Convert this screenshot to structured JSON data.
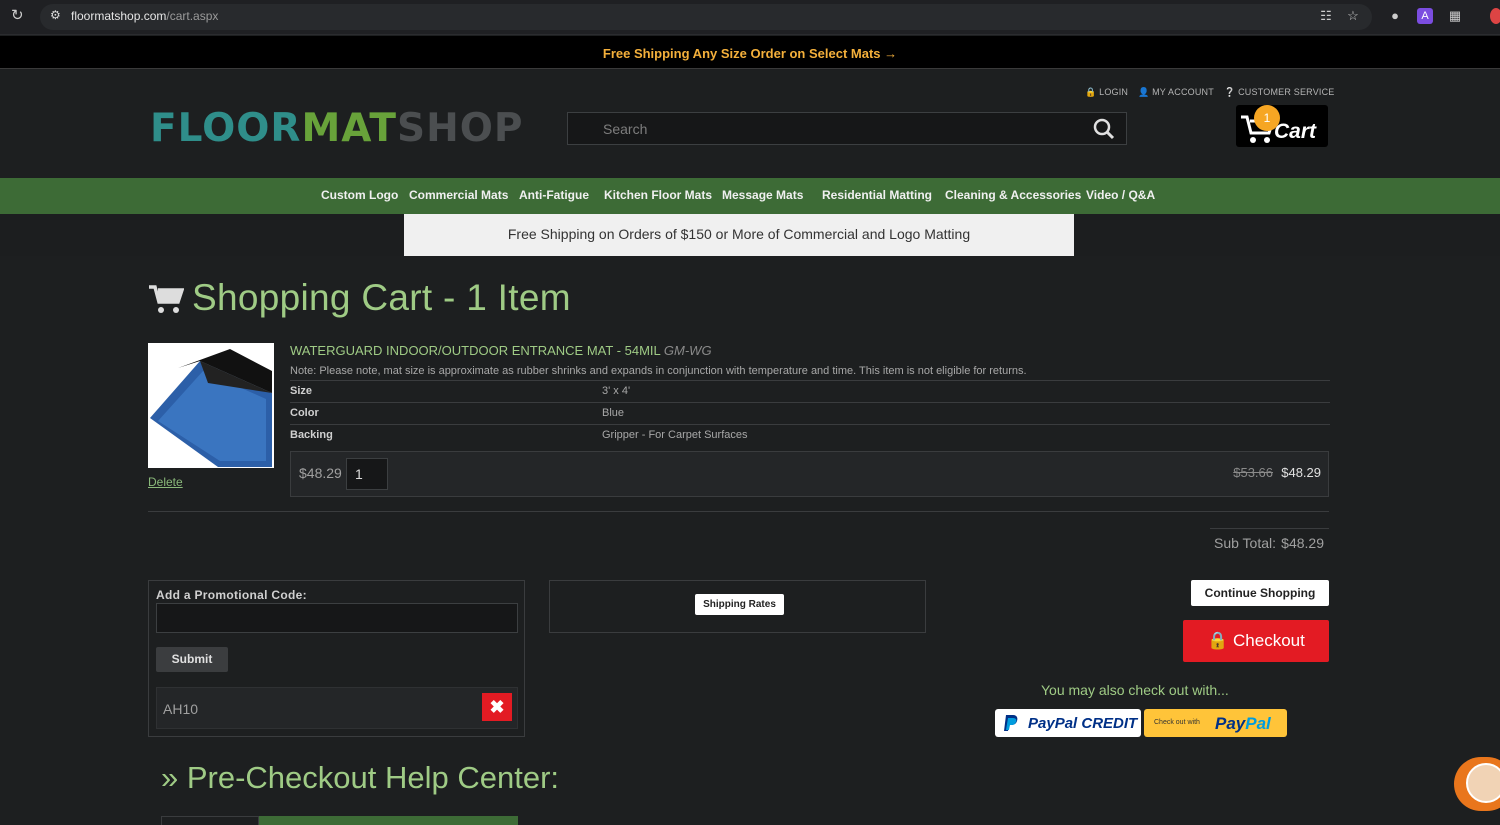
{
  "browser": {
    "url_domain": "floormatshop.com",
    "url_path": "/cart.aspx"
  },
  "promo_bar": {
    "text": "Free Shipping Any Size Order on Select Mats →"
  },
  "header": {
    "logo": {
      "part1": "FLOOR",
      "part2": "MAT",
      "part3": "SHOP"
    },
    "search_placeholder": "Search",
    "links": {
      "login": "LOGIN",
      "account": "MY ACCOUNT",
      "service": "CUSTOMER SERVICE"
    },
    "cart": {
      "count": "1",
      "label": "Cart"
    }
  },
  "nav": {
    "items": [
      "Custom Logo",
      "Commercial Mats",
      "Anti-Fatigue",
      "Kitchen Floor Mats",
      "Message Mats",
      "Residential Matting",
      "Cleaning & Accessories",
      "Video / Q&A"
    ]
  },
  "shipping_banner": "Free Shipping on Orders of $150 or More of Commercial and Logo Matting",
  "cart": {
    "title": "Shopping Cart - 1 Item",
    "item": {
      "name": "WATERGUARD INDOOR/OUTDOOR ENTRANCE MAT - 54MIL",
      "sku": "GM-WG",
      "note": "Note: Please note, mat size is approximate as rubber shrinks and expands in conjunction with temperature and time. This item is not eligible for returns.",
      "attributes": [
        {
          "key": "Size",
          "value": "3' x 4'"
        },
        {
          "key": "Color",
          "value": "Blue"
        },
        {
          "key": "Backing",
          "value": "Gripper - For Carpet Surfaces"
        }
      ],
      "unit_price": "$48.29",
      "quantity": "1",
      "old_price": "$53.66",
      "price": "$48.29",
      "delete_label": "Delete"
    },
    "subtotal_label": "Sub Total:",
    "subtotal_value": "$48.29"
  },
  "promo_code": {
    "label": "Add a Promotional Code:",
    "submit_label": "Submit",
    "applied_code": "AH10"
  },
  "shipping_rates_label": "Shipping Rates",
  "actions": {
    "continue_label": "Continue Shopping",
    "checkout_label": "Checkout",
    "also_checkout": "You may also check out with...",
    "paypal_credit": "PayPal CREDIT",
    "paypal_check_small": "Check out with",
    "paypal_pay": "Pay",
    "paypal_pal": "Pal"
  },
  "help_center": {
    "title": "» Pre-Checkout Help Center:"
  },
  "colors": {
    "accent_green": "#9fcb85",
    "nav_green": "#3d6b36",
    "checkout_red": "#e31b23",
    "promo_orange": "#f4b03b"
  }
}
